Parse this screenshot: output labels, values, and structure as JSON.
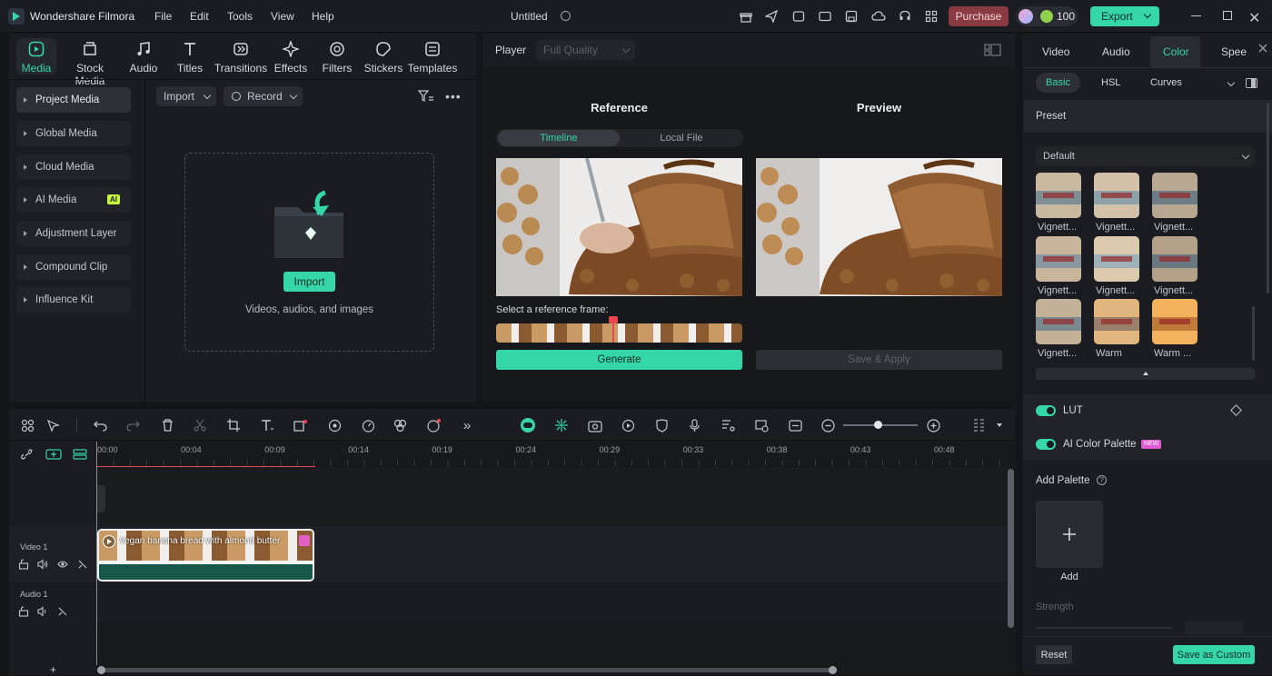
{
  "app": {
    "name": "Wondershare Filmora",
    "menu": [
      "File",
      "Edit",
      "Tools",
      "View",
      "Help"
    ],
    "project_title": "Untitled",
    "purchase": "Purchase",
    "credits": "100",
    "export": "Export"
  },
  "media_tabs": [
    "Media",
    "Stock Media",
    "Audio",
    "Titles",
    "Transitions",
    "Effects",
    "Filters",
    "Stickers",
    "Templates"
  ],
  "sidebar": [
    "Project Media",
    "Global Media",
    "Cloud Media",
    "AI Media",
    "Adjustment Layer",
    "Compound Clip",
    "Influence Kit"
  ],
  "ai_badge": "AI",
  "media_toolbar": {
    "import": "Import",
    "record": "Record"
  },
  "import_area": {
    "button": "Import",
    "hint": "Videos, audios, and images"
  },
  "player": {
    "label": "Player",
    "quality": "Full Quality"
  },
  "match": {
    "reference": "Reference",
    "preview": "Preview",
    "tab_timeline": "Timeline",
    "tab_local": "Local File",
    "select_frame": "Select a reference frame:",
    "generate": "Generate",
    "save_apply": "Save & Apply"
  },
  "props": {
    "tabs": [
      "Video",
      "Audio",
      "Color",
      "Speed"
    ],
    "subtabs": [
      "Basic",
      "HSL",
      "Curves"
    ],
    "preset_header": "Preset",
    "preset_value": "Default",
    "presets": [
      "Vignett...",
      "Vignett...",
      "Vignett...",
      "Vignett...",
      "Vignett...",
      "Vignett...",
      "Vignett...",
      "Warm",
      "Warm ..."
    ],
    "lut": "LUT",
    "ai_palette": "AI Color Palette",
    "new_badge": "NEW",
    "add_palette": "Add Palette",
    "add": "Add",
    "strength": "Strength",
    "reset": "Reset",
    "save_custom": "Save as Custom"
  },
  "timeline": {
    "ruler": [
      "00:00",
      "00:04",
      "00:09",
      "00:14",
      "00:19",
      "00:24",
      "00:29",
      "00:33",
      "00:38",
      "00:43",
      "00:48"
    ],
    "video_track": "Video 1",
    "audio_track": "Audio 1",
    "clip_name": "Vegan banana bread with almond butter"
  },
  "colors": {
    "accent": "#35d6a8",
    "purchase": "#8a3b42",
    "playhead": "#e8454e"
  }
}
